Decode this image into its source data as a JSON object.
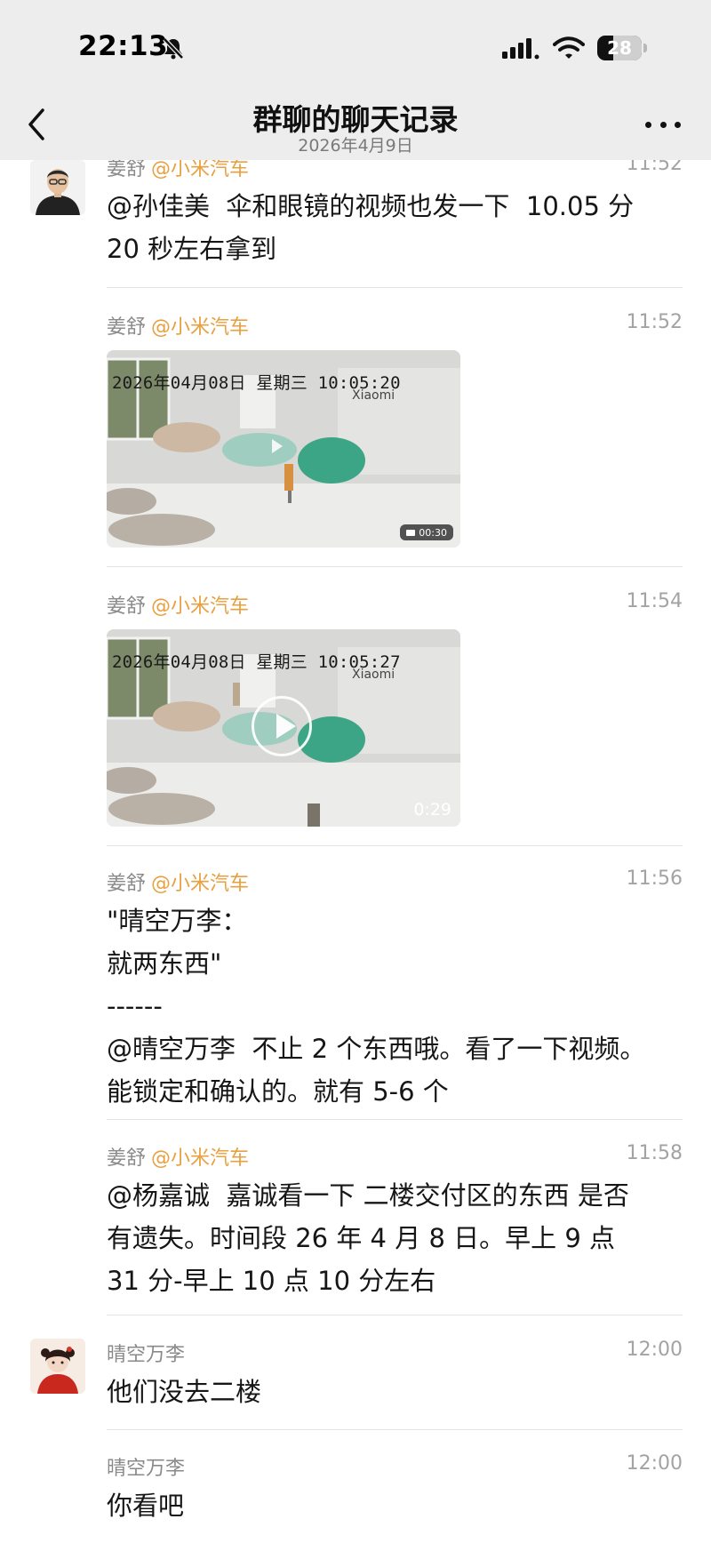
{
  "status_bar": {
    "time": "22:13",
    "battery": "28"
  },
  "header": {
    "title": "群聊的聊天记录",
    "subtitle": "2026年4月9日"
  },
  "messages": [
    {
      "sender": "姜舒",
      "org": "@小米汽车",
      "time": "11:52",
      "text": "@孙佳美  伞和眼镜的视频也发一下  10.05 分\n20 秒左右拿到"
    },
    {
      "sender": "姜舒",
      "org": "@小米汽车",
      "time": "11:52",
      "video": {
        "timestamp": "2026年04月08日 星期三 10:05:20",
        "brand": "Xiaomi",
        "duration": "00:30"
      }
    },
    {
      "sender": "姜舒",
      "org": "@小米汽车",
      "time": "11:54",
      "video": {
        "timestamp": "2026年04月08日 星期三 10:05:27",
        "brand": "Xiaomi",
        "duration": "0:29"
      }
    },
    {
      "sender": "姜舒",
      "org": "@小米汽车",
      "time": "11:56",
      "text": "\"晴空万李：\n就两东西\"\n------\n@晴空万李  不止 2 个东西哦。看了一下视频。\n能锁定和确认的。就有 5-6 个"
    },
    {
      "sender": "姜舒",
      "org": "@小米汽车",
      "time": "11:58",
      "text": "@杨嘉诚  嘉诚看一下 二楼交付区的东西 是否\n有遗失。时间段 26 年 4 月 8 日。早上 9 点\n31 分-早上 10 点 10 分左右"
    },
    {
      "sender": "晴空万李",
      "time": "12:00",
      "text": "他们没去二楼"
    },
    {
      "sender": "晴空万李",
      "time": "12:00",
      "text": "你看吧"
    }
  ],
  "colors": {
    "org": "#e8a040",
    "header_bg": "#ededed"
  }
}
